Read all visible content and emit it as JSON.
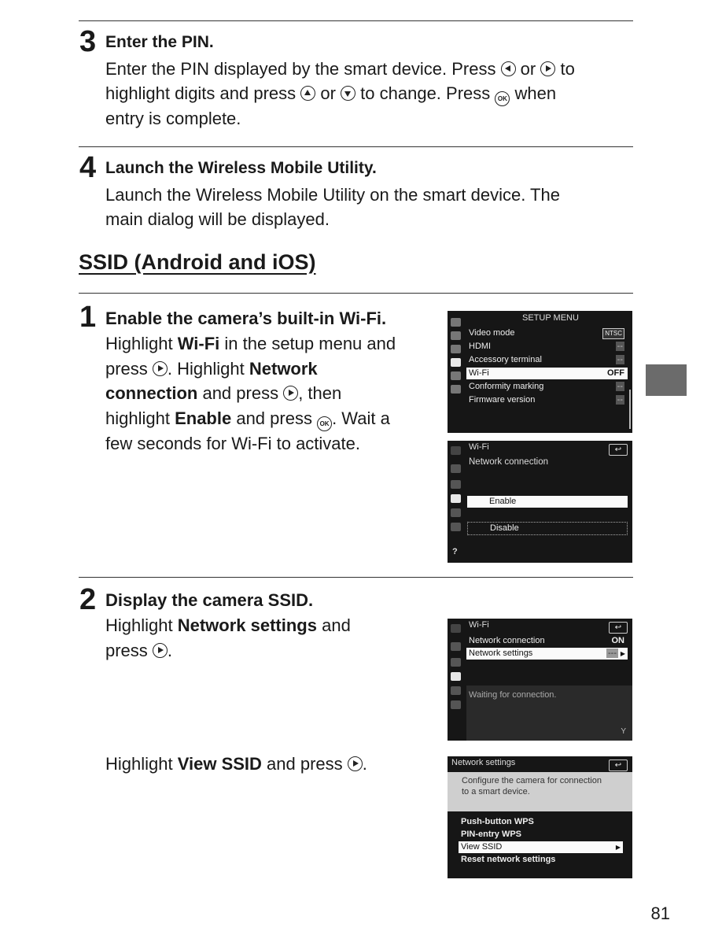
{
  "step3": {
    "number": "3",
    "title": "Enter the PIN.",
    "line1_a": "Enter the PIN displayed by the smart device.  Press ",
    "line1_b": " or ",
    "line1_c": " to",
    "line2_a": "highlight digits and press ",
    "line2_b": " or ",
    "line2_c": " to change.  Press ",
    "line2_d": " when",
    "line3": "entry is complete."
  },
  "step4": {
    "number": "4",
    "title": "Launch the Wireless Mobile Utility.",
    "line1": "Launch the Wireless Mobile Utility on the smart device.  The",
    "line2": "main dialog will be displayed."
  },
  "section": {
    "title": "SSID (Android and iOS)"
  },
  "ssid_step1": {
    "number": "1",
    "title": "Enable the camera’s built-in Wi-Fi.",
    "t1": "Highlight ",
    "b1": "Wi-Fi",
    "t2": " in the setup menu and",
    "t3": "press ",
    "t4": ".  Highlight ",
    "b2": "Network",
    "b3": "connection",
    "t5": " and press ",
    "t6": ", then",
    "t7": "highlight ",
    "b4": "Enable",
    "t8": " and press ",
    "t9": ".  Wait a",
    "t10": "few seconds for Wi-Fi to activate."
  },
  "ssid_step2": {
    "number": "2",
    "title": "Display the camera SSID.",
    "t1": "Highlight ",
    "b1": "Network settings",
    "t2": " and",
    "t3": "press ",
    "t4": ".",
    "t5": "Highlight ",
    "b2": "View SSID",
    "t6": " and press ",
    "t7": "."
  },
  "icons": {
    "ok": "OK"
  },
  "screen_setup": {
    "title": "SETUP MENU",
    "items": [
      {
        "label": "Video mode",
        "value": "NTSC"
      },
      {
        "label": "HDMI",
        "value": "--"
      },
      {
        "label": "Accessory terminal",
        "value": "--"
      },
      {
        "label": "Wi-Fi",
        "value": "OFF"
      },
      {
        "label": "Conformity marking",
        "value": "--"
      },
      {
        "label": "Firmware version",
        "value": "--"
      }
    ]
  },
  "screen_wifi_conn": {
    "breadcrumb": "Wi-Fi",
    "title": "Network connection",
    "back": "↩",
    "options": [
      "Enable",
      "Disable"
    ],
    "help": "?"
  },
  "screen_wifi": {
    "title": "Wi-Fi",
    "back": "↩",
    "items": [
      {
        "label": "Network connection",
        "value": "ON"
      },
      {
        "label": "Network settings",
        "value": "---"
      }
    ],
    "status": "Waiting for connection."
  },
  "screen_netsettings": {
    "title": "Network settings",
    "back": "↩",
    "desc1": "Configure the camera for connection",
    "desc2": "to a smart device.",
    "items": [
      "Push-button WPS",
      "PIN-entry WPS",
      "View SSID",
      "Reset network settings"
    ]
  },
  "page_number": "81"
}
